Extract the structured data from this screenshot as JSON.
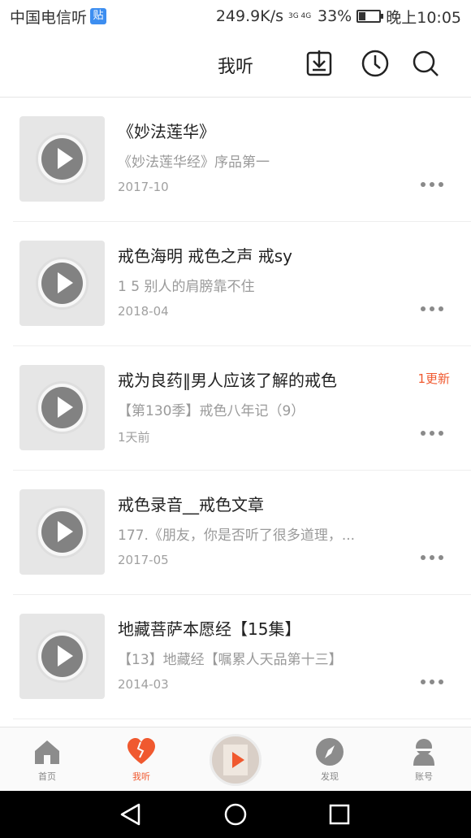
{
  "status_bar": {
    "carrier": "中国电信听",
    "carrier_badge": "贴",
    "speed": "249.9K/s",
    "network": "3G 4G",
    "battery": "33%",
    "battery_level": 0.33,
    "time": "晚上10:05"
  },
  "header": {
    "title": "我听",
    "icons": [
      "download-icon",
      "history-icon",
      "search-icon"
    ]
  },
  "items": [
    {
      "title": "《妙法莲华》",
      "subtitle": "《妙法莲华经》序品第一",
      "date": "2017-10",
      "badge": ""
    },
    {
      "title": "戒色海明 戒色之声 戒sy",
      "subtitle": "1 5 别人的肩膀靠不住",
      "date": "2018-04",
      "badge": ""
    },
    {
      "title": "戒为良药‖男人应该了解的戒色",
      "subtitle": "【第130季】戒色八年记（9）",
      "date": "1天前",
      "badge": "1更新"
    },
    {
      "title": "戒色录音__戒色文章",
      "subtitle": "177.《朋友，你是否听了很多道理，...",
      "date": "2017-05",
      "badge": ""
    },
    {
      "title": "地藏菩萨本愿经【15集】",
      "subtitle": "【13】地藏经【嘱累人天品第十三】",
      "date": "2014-03",
      "badge": ""
    }
  ],
  "tabbar": {
    "home": "首页",
    "mine": "我听",
    "discover": "发现",
    "account": "账号"
  },
  "colors": {
    "accent": "#f0592f",
    "text": "#222222",
    "muted": "#9a9a9a"
  }
}
